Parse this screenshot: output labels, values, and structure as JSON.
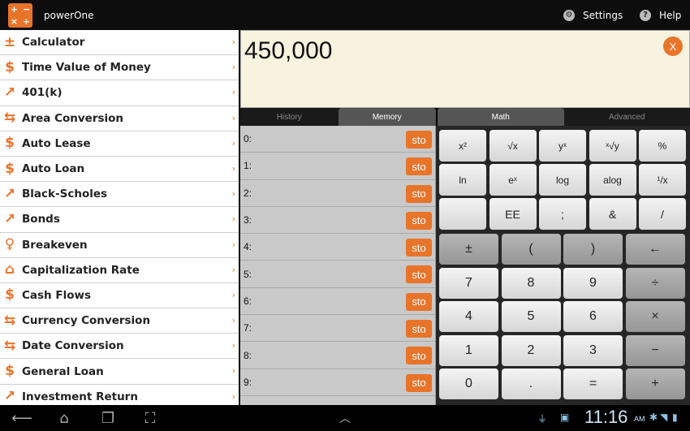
{
  "app": {
    "title": "powerOne",
    "logo_glyphs": [
      "+",
      "−",
      "×",
      "÷"
    ]
  },
  "topbar": {
    "settings_label": "Settings",
    "help_label": "Help"
  },
  "sidebar": {
    "items": [
      {
        "label": "Calculator",
        "icon": "calculator-icon"
      },
      {
        "label": "Time Value of Money",
        "icon": "dollar-icon"
      },
      {
        "label": "401(k)",
        "icon": "chart-trend-icon"
      },
      {
        "label": "Area Conversion",
        "icon": "convert-arrows-icon"
      },
      {
        "label": "Auto Lease",
        "icon": "dollar-icon"
      },
      {
        "label": "Auto Loan",
        "icon": "dollar-icon"
      },
      {
        "label": "Black-Scholes",
        "icon": "chart-trend-icon"
      },
      {
        "label": "Bonds",
        "icon": "chart-trend-icon"
      },
      {
        "label": "Breakeven",
        "icon": "lightbulb-icon"
      },
      {
        "label": "Capitalization Rate",
        "icon": "house-icon"
      },
      {
        "label": "Cash Flows",
        "icon": "dollar-icon"
      },
      {
        "label": "Currency Conversion",
        "icon": "convert-arrows-icon"
      },
      {
        "label": "Date Conversion",
        "icon": "convert-arrows-icon"
      },
      {
        "label": "General Loan",
        "icon": "dollar-icon"
      },
      {
        "label": "Investment Return",
        "icon": "chart-trend-icon"
      }
    ]
  },
  "display": {
    "value": "450,000",
    "clear_label": "X"
  },
  "memory_tabs": [
    {
      "label": "History",
      "active": false
    },
    {
      "label": "Memory",
      "active": true
    }
  ],
  "keypad_tabs": [
    {
      "label": "Math",
      "active": true
    },
    {
      "label": "Advanced",
      "active": false
    }
  ],
  "memory": {
    "sto_label": "sto",
    "slots": [
      "0:",
      "1:",
      "2:",
      "3:",
      "4:",
      "5:",
      "6:",
      "7:",
      "8:",
      "9:"
    ]
  },
  "keys": {
    "row1": [
      "x²",
      "√x",
      "yˣ",
      "ˣ√y",
      "%"
    ],
    "row2": [
      "ln",
      "eˣ",
      "log",
      "alog",
      "¹/x"
    ],
    "row3": [
      "",
      "EE",
      ";",
      "&",
      "/"
    ],
    "row4": [
      "±",
      "(",
      ")",
      "←"
    ],
    "row5": [
      "7",
      "8",
      "9",
      "÷"
    ],
    "row6": [
      "4",
      "5",
      "6",
      "×"
    ],
    "row7": [
      "1",
      "2",
      "3",
      "−"
    ],
    "row8": [
      "0",
      ".",
      "=",
      "+"
    ]
  },
  "status": {
    "time": "11:16",
    "ampm": "AM"
  },
  "colors": {
    "accent": "#e8742a",
    "display_bg": "#f7f3df"
  }
}
